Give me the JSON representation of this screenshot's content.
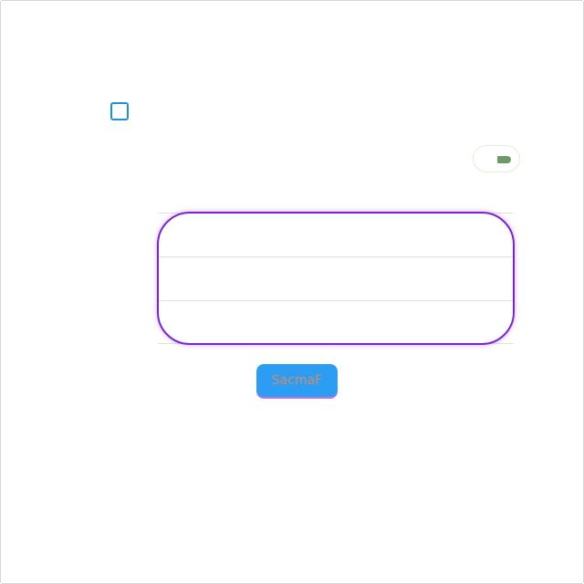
{
  "checkbox": {
    "checked": false,
    "color": "#1e90d6"
  },
  "toggle": {
    "on": true,
    "knob_color": "#6e9a6a"
  },
  "table": {
    "rows": [
      {
        "text": ""
      },
      {
        "text": ""
      },
      {
        "text": ""
      }
    ],
    "outline_color": "#7b22d8"
  },
  "submit": {
    "label": "SacmaF",
    "background": "#2b9df2",
    "text_color": "#d78a6a"
  }
}
